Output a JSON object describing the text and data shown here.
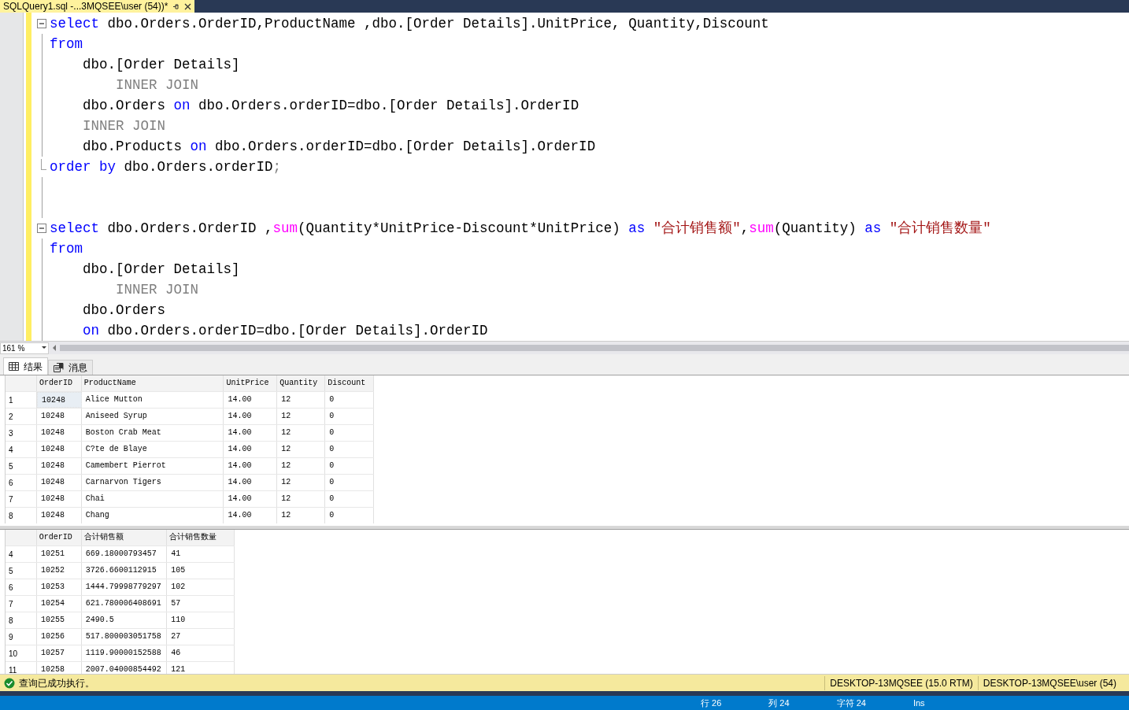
{
  "document_tab": {
    "title": "SQLQuery1.sql -...3MQSEE\\user (54))*"
  },
  "editor": {
    "lines": [
      {
        "kind": "block_start",
        "tokens": [
          {
            "kind": "kw",
            "text": "select"
          },
          {
            "kind": "id",
            "text": " dbo.Orders.OrderID,ProductName ,dbo.[Order Details].UnitPrice, Quantity,Discount"
          }
        ]
      },
      {
        "kind": "line",
        "tokens": [
          {
            "kind": "kw",
            "text": "from"
          }
        ]
      },
      {
        "kind": "line",
        "tokens": [
          {
            "kind": "id",
            "text": "    dbo.[Order Details]"
          }
        ]
      },
      {
        "kind": "line",
        "tokens": [
          {
            "kind": "gray",
            "text": "        INNER JOIN"
          }
        ]
      },
      {
        "kind": "line",
        "tokens": [
          {
            "kind": "id",
            "text": "    dbo.Orders "
          },
          {
            "kind": "kw",
            "text": "on"
          },
          {
            "kind": "id",
            "text": " dbo.Orders.orderID=dbo.[Order Details].OrderID"
          }
        ]
      },
      {
        "kind": "line",
        "tokens": [
          {
            "kind": "gray",
            "text": "    INNER JOIN"
          }
        ]
      },
      {
        "kind": "line",
        "tokens": [
          {
            "kind": "id",
            "text": "    dbo.Products "
          },
          {
            "kind": "kw",
            "text": "on"
          },
          {
            "kind": "id",
            "text": " dbo.Orders.orderID=dbo.[Order Details].OrderID"
          }
        ]
      },
      {
        "kind": "block_end",
        "tokens": [
          {
            "kind": "kw",
            "text": "order by"
          },
          {
            "kind": "id",
            "text": " dbo.Orders.orderID"
          },
          {
            "kind": "gray",
            "text": ";"
          }
        ]
      },
      {
        "kind": "blank"
      },
      {
        "kind": "blank"
      },
      {
        "kind": "block_start",
        "tokens": [
          {
            "kind": "kw",
            "text": "select"
          },
          {
            "kind": "id",
            "text": " dbo.Orders.OrderID ,"
          },
          {
            "kind": "fn",
            "text": "sum"
          },
          {
            "kind": "id",
            "text": "(Quantity*UnitPrice-Discount*UnitPrice) "
          },
          {
            "kind": "kw",
            "text": "as"
          },
          {
            "kind": "str",
            "text": " \"合计销售额\""
          },
          {
            "kind": "id",
            "text": ","
          },
          {
            "kind": "fn",
            "text": "sum"
          },
          {
            "kind": "id",
            "text": "(Quantity) "
          },
          {
            "kind": "kw",
            "text": "as"
          },
          {
            "kind": "str",
            "text": " \"合计销售数量\""
          }
        ]
      },
      {
        "kind": "line",
        "tokens": [
          {
            "kind": "kw",
            "text": "from"
          }
        ]
      },
      {
        "kind": "line",
        "tokens": [
          {
            "kind": "id",
            "text": "    dbo.[Order Details]"
          }
        ]
      },
      {
        "kind": "line",
        "tokens": [
          {
            "kind": "gray",
            "text": "        INNER JOIN"
          }
        ]
      },
      {
        "kind": "line",
        "tokens": [
          {
            "kind": "id",
            "text": "    dbo.Orders"
          }
        ]
      },
      {
        "kind": "line",
        "tokens": [
          {
            "kind": "kw",
            "text": "    on"
          },
          {
            "kind": "id",
            "text": " dbo.Orders.orderID=dbo.[Order Details].OrderID"
          }
        ]
      }
    ]
  },
  "zoom": {
    "value": "161 %"
  },
  "result_tabs": [
    {
      "label": "结果",
      "kind": "grid",
      "selected": true
    },
    {
      "label": "消息",
      "kind": "messages",
      "selected": false
    }
  ],
  "grids": [
    {
      "columns": [
        "OrderID",
        "ProductName",
        "UnitPrice",
        "Quantity",
        "Discount"
      ],
      "rows": [
        {
          "number": "1",
          "selected": true,
          "cells": [
            "10248",
            "Alice Mutton",
            "14.00",
            "12",
            "0"
          ]
        },
        {
          "number": "2",
          "selected": false,
          "cells": [
            "10248",
            "Aniseed Syrup",
            "14.00",
            "12",
            "0"
          ]
        },
        {
          "number": "3",
          "selected": false,
          "cells": [
            "10248",
            "Boston Crab Meat",
            "14.00",
            "12",
            "0"
          ]
        },
        {
          "number": "4",
          "selected": false,
          "cells": [
            "10248",
            "C?te de Blaye",
            "14.00",
            "12",
            "0"
          ]
        },
        {
          "number": "5",
          "selected": false,
          "cells": [
            "10248",
            "Camembert Pierrot",
            "14.00",
            "12",
            "0"
          ]
        },
        {
          "number": "6",
          "selected": false,
          "cells": [
            "10248",
            "Carnarvon Tigers",
            "14.00",
            "12",
            "0"
          ]
        },
        {
          "number": "7",
          "selected": false,
          "cells": [
            "10248",
            "Chai",
            "14.00",
            "12",
            "0"
          ]
        },
        {
          "number": "8",
          "selected": false,
          "cells": [
            "10248",
            "Chang",
            "14.00",
            "12",
            "0"
          ]
        }
      ]
    },
    {
      "columns": [
        "OrderID",
        "合计销售额",
        "合计销售数量"
      ],
      "rows": [
        {
          "number": "4",
          "selected": false,
          "cells": [
            "10251",
            "669.18000793457",
            "41"
          ]
        },
        {
          "number": "5",
          "selected": false,
          "cells": [
            "10252",
            "3726.6600112915",
            "105"
          ]
        },
        {
          "number": "6",
          "selected": false,
          "cells": [
            "10253",
            "1444.79998779297",
            "102"
          ]
        },
        {
          "number": "7",
          "selected": false,
          "cells": [
            "10254",
            "621.780006408691",
            "57"
          ]
        },
        {
          "number": "8",
          "selected": false,
          "cells": [
            "10255",
            "2490.5",
            "110"
          ]
        },
        {
          "number": "9",
          "selected": false,
          "cells": [
            "10256",
            "517.800003051758",
            "27"
          ]
        },
        {
          "number": "10",
          "selected": false,
          "cells": [
            "10257",
            "1119.90000152588",
            "46"
          ]
        },
        {
          "number": "11",
          "selected": false,
          "cells": [
            "10258",
            "2007.04000854492",
            "121"
          ]
        }
      ]
    }
  ],
  "status_bar": {
    "message": "查询已成功执行。",
    "success": true,
    "server": "DESKTOP-13MQSEE (15.0 RTM)",
    "connection": "DESKTOP-13MQSEE\\user (54)"
  },
  "editor_status": [
    "行 26",
    "列 24",
    "字符 24",
    "Ins"
  ]
}
